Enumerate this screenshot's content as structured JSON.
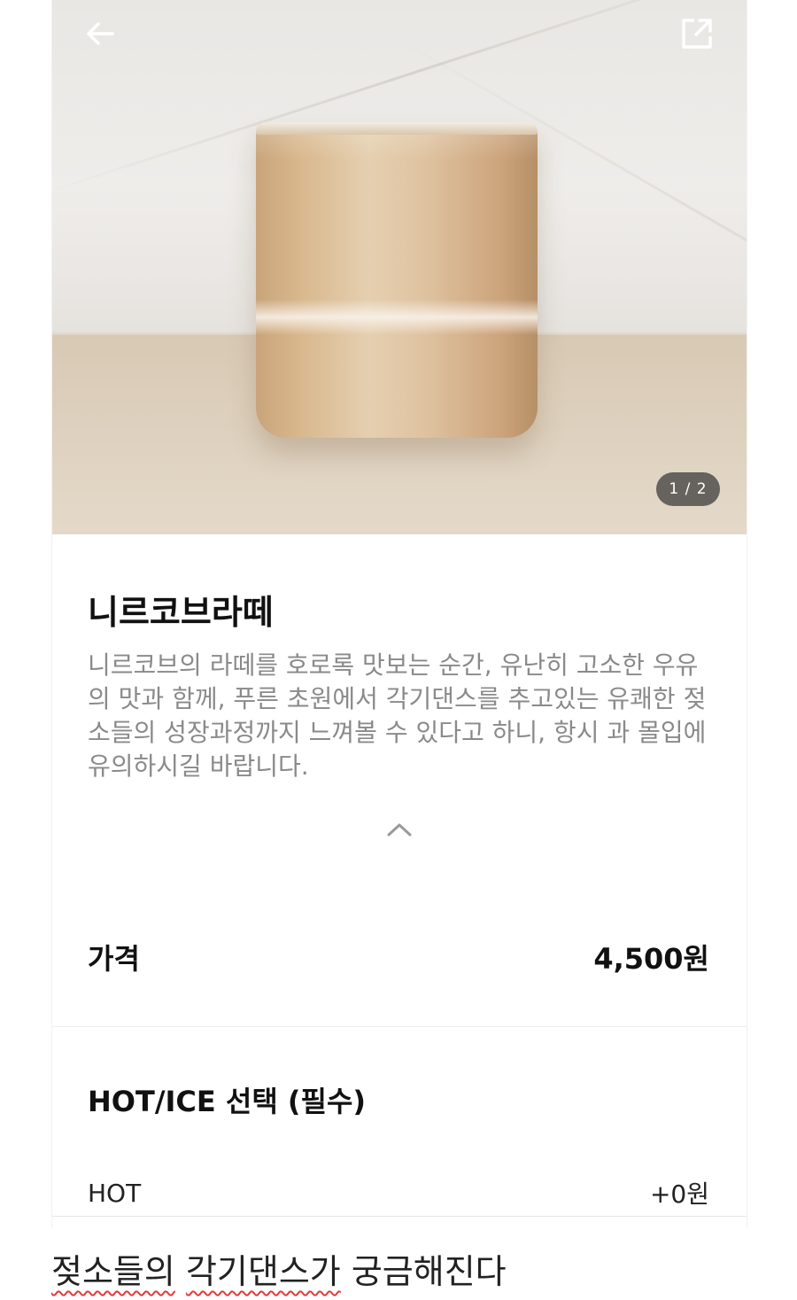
{
  "hero": {
    "pager_text": "1 / 2"
  },
  "product": {
    "name": "니르코브라떼",
    "description": "니르코브의 라떼를 호로록 맛보는 순간, 유난히 고소한 우유의 맛과 함께, 푸른 초원에서 각기댄스를 추고있는 유쾌한 젖소들의 성장과정까지 느껴볼 수 있다고 하니, 항시 과 몰입에 유의하시길 바랍니다."
  },
  "price": {
    "label": "가격",
    "value": "4,500원"
  },
  "option_group": {
    "title": "HOT/ICE 선택 (필수)",
    "options": [
      {
        "label": "HOT",
        "price": "+0원"
      }
    ]
  },
  "caption": {
    "part1": "젖소들의",
    "part2": "각기댄스가",
    "part3": "궁금해진다"
  },
  "icons": {
    "back": "back-arrow-icon",
    "share": "share-icon",
    "collapse": "chevron-up-icon"
  }
}
